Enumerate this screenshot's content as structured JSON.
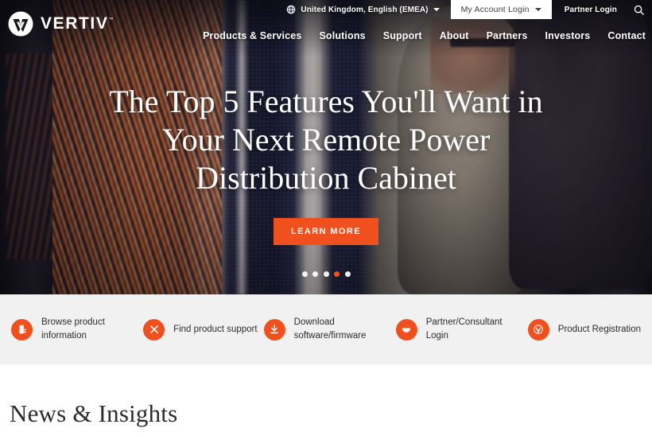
{
  "brand": {
    "name": "VERTIV",
    "trademark": "™",
    "logo_icon": "vertiv-logo-icon",
    "accent_color": "#f0501e"
  },
  "topbar": {
    "globe_icon": "globe-icon",
    "locale": "United Kingdom, English (EMEA)",
    "locale_caret_icon": "chevron-down-icon",
    "account_login": "My Account Login",
    "account_caret_icon": "chevron-down-icon",
    "partner_login": "Partner Login",
    "search_icon": "search-icon"
  },
  "mainnav": {
    "items": [
      {
        "label": "Products & Services"
      },
      {
        "label": "Solutions"
      },
      {
        "label": "Support"
      },
      {
        "label": "About"
      },
      {
        "label": "Partners"
      },
      {
        "label": "Investors"
      },
      {
        "label": "Contact"
      }
    ]
  },
  "hero": {
    "title": "The Top 5 Features You'll Want in Your Next Remote Power Distribution Cabinet",
    "cta_label": "LEARN MORE",
    "slides_total": 5,
    "active_slide": 4
  },
  "quicklinks": {
    "items": [
      {
        "label": "Browse product information",
        "icon": "document-icon"
      },
      {
        "label": "Find product support",
        "icon": "tools-icon"
      },
      {
        "label": "Download software/firmware",
        "icon": "download-icon"
      },
      {
        "label": "Partner/Consultant Login",
        "icon": "handshake-icon"
      },
      {
        "label": "Product Registration",
        "icon": "vertiv-badge-icon"
      }
    ]
  },
  "news": {
    "title": "News & Insights"
  }
}
